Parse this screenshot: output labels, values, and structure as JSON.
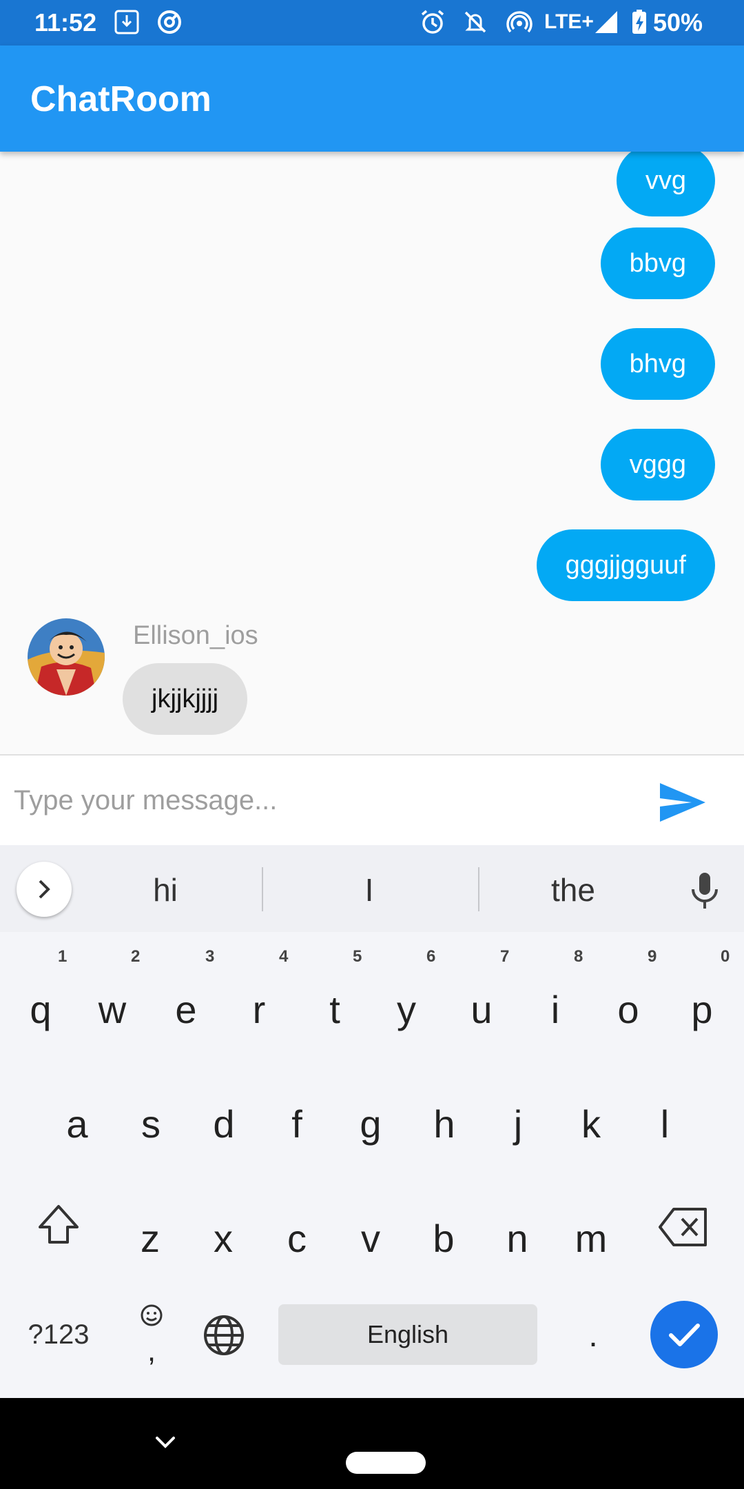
{
  "status_bar": {
    "time": "11:52",
    "network": "LTE+",
    "battery": "50%",
    "icons": [
      "download-icon",
      "vpn-icon",
      "alarm-icon",
      "mute-icon",
      "hotspot-icon",
      "signal-icon",
      "battery-icon"
    ]
  },
  "app_bar": {
    "title": "ChatRoom"
  },
  "chat": {
    "outgoing": [
      {
        "text": "vvg"
      },
      {
        "text": "bbvg"
      },
      {
        "text": "bhvg"
      },
      {
        "text": "vggg"
      },
      {
        "text": "gggjjgguuf"
      }
    ],
    "incoming": {
      "sender": "Ellison_ios",
      "text": "jkjjkjjjj",
      "avatar": "avatar-icon"
    }
  },
  "composer": {
    "placeholder": "Type your message...",
    "value": "",
    "send_icon": "send-icon"
  },
  "keyboard": {
    "suggestions": [
      "hi",
      "I",
      "the"
    ],
    "row1": [
      "q",
      "w",
      "e",
      "r",
      "t",
      "y",
      "u",
      "i",
      "o",
      "p"
    ],
    "row1_hints": [
      "1",
      "2",
      "3",
      "4",
      "5",
      "6",
      "7",
      "8",
      "9",
      "0"
    ],
    "row2": [
      "a",
      "s",
      "d",
      "f",
      "g",
      "h",
      "j",
      "k",
      "l"
    ],
    "row3": [
      "z",
      "x",
      "c",
      "v",
      "b",
      "n",
      "m"
    ],
    "symbols_label": "?123",
    "comma": ",",
    "space_label": "English",
    "period": "."
  },
  "colors": {
    "status_bar": "#1976d2",
    "app_bar": "#2196f3",
    "outgoing_bubble": "#03a9f4",
    "incoming_bubble": "#e0e0e0",
    "enter_key": "#1a73e8"
  }
}
